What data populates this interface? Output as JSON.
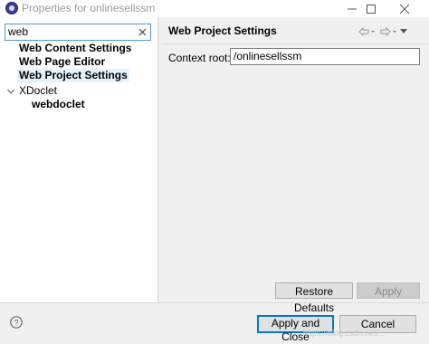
{
  "window": {
    "title": "Properties for onlinesellssm"
  },
  "filter": {
    "value": "web"
  },
  "tree": {
    "items": [
      {
        "label": "Web Content Settings"
      },
      {
        "label": "Web Page Editor"
      },
      {
        "label": "Web Project Settings",
        "selected": true
      },
      {
        "label": "XDoclet",
        "expanded": true
      },
      {
        "label": "webdoclet"
      }
    ]
  },
  "page": {
    "title": "Web Project Settings",
    "context_root_label": "Context root:",
    "context_root_value": "/onlinesellssm"
  },
  "buttons": {
    "restore_defaults": "Restore Defaults",
    "apply": "Apply",
    "apply_and_close": "Apply and Close",
    "cancel": "Cancel"
  },
  "watermark": {
    "text": "https://blog.csdn.net/..."
  }
}
